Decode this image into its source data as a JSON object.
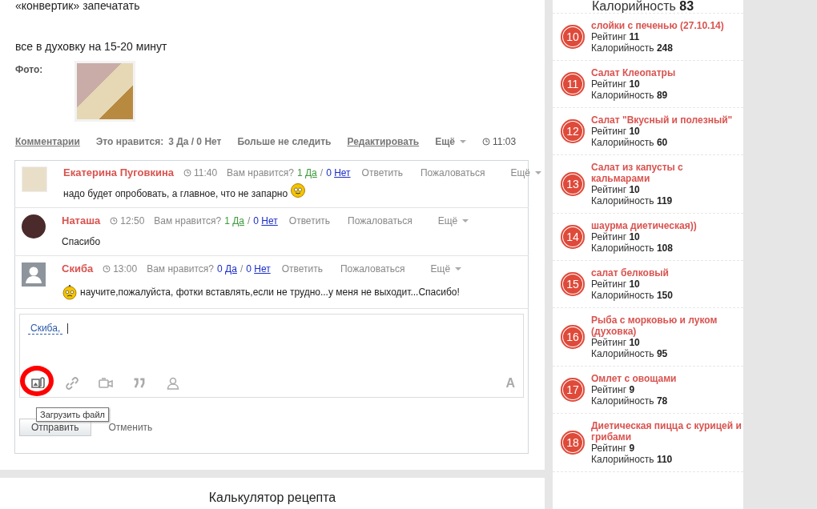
{
  "post": {
    "top_line": "«конвертик» запечатать",
    "instruction": "все в духовку на 15-20 минут",
    "photo_label": "Фото:"
  },
  "actions": {
    "comments": "Комментарии",
    "likes_label": "Это нравится:",
    "likes_value": "3 Да / 0 Нет",
    "unfollow": "Больше не следить",
    "edit": "Редактировать",
    "more": "Ещё",
    "time": "11:03"
  },
  "comments": [
    {
      "author": "Екатерина Пуговкина",
      "time": "11:40",
      "question": "Вам нравится?",
      "yes_count": "1",
      "yes": "Да",
      "yes_highlighted": true,
      "separator": "/",
      "no_count": "0",
      "no": "Нет",
      "reply": "Ответить",
      "report": "Пожаловаться",
      "more": "Ещё",
      "avatar": {
        "kind": "picture"
      },
      "content": [
        {
          "kind": "text",
          "text": "надо будет опробовать, а главное, что не запарно"
        },
        {
          "kind": "smiley"
        }
      ]
    },
    {
      "author": "Наташа",
      "time": "12:50",
      "question": "Вам нравится?",
      "yes_count": "1",
      "yes": "Да",
      "yes_highlighted": true,
      "separator": "/",
      "no_count": "0",
      "no": "Нет",
      "reply": "Ответить",
      "report": "Пожаловаться",
      "more": "Ещё",
      "avatar": {
        "kind": "photo"
      },
      "content": [
        {
          "kind": "text",
          "text": "Спасибо"
        }
      ]
    },
    {
      "author": "Скиба",
      "time": "13:00",
      "question": "Вам нравится?",
      "yes_count": "0",
      "yes": "Да",
      "yes_highlighted": false,
      "separator": "/",
      "no_count": "0",
      "no": "Нет",
      "reply": "Ответить",
      "report": "Пожаловаться",
      "more": "Ещё",
      "avatar": {
        "kind": "silhouette"
      },
      "content": [
        {
          "kind": "sad"
        },
        {
          "kind": "text",
          "text": "научите,пожалуйста, фотки вставлять,если не трудно...у меня не выходит...Спасибо!"
        }
      ]
    }
  ],
  "editor": {
    "mention": "Скиба,",
    "format_button": "A",
    "tooltip": "Загрузить файл",
    "submit": "Отправить",
    "cancel": "Отменить",
    "upload_highlighted": true
  },
  "calculator": {
    "title": "Калькулятор рецепта"
  },
  "sidebar": {
    "top_fragment": {
      "calories_label": "Калорийность",
      "calories": "83"
    },
    "items": [
      {
        "rank": "10",
        "title": "слойки с печенью (27.10.14)",
        "rating_label": "Рейтинг",
        "rating": "11",
        "calories_label": "Калорийность",
        "calories": "248"
      },
      {
        "rank": "11",
        "title": "Салат Клеопатры",
        "rating_label": "Рейтинг",
        "rating": "10",
        "calories_label": "Калорийность",
        "calories": "89"
      },
      {
        "rank": "12",
        "title": "Салат \"Вкусный и полезный\"",
        "rating_label": "Рейтинг",
        "rating": "10",
        "calories_label": "Калорийность",
        "calories": "60"
      },
      {
        "rank": "13",
        "title": "Салат из капусты с кальмарами",
        "rating_label": "Рейтинг",
        "rating": "10",
        "calories_label": "Калорийность",
        "calories": "119"
      },
      {
        "rank": "14",
        "title": "шаурма диетическая))",
        "rating_label": "Рейтинг",
        "rating": "10",
        "calories_label": "Калорийность",
        "calories": "108"
      },
      {
        "rank": "15",
        "title": "салат белковый",
        "rating_label": "Рейтинг",
        "rating": "10",
        "calories_label": "Калорийность",
        "calories": "150"
      },
      {
        "rank": "16",
        "title": "Рыба с морковью и луком (духовка)",
        "rating_label": "Рейтинг",
        "rating": "10",
        "calories_label": "Калорийность",
        "calories": "95"
      },
      {
        "rank": "17",
        "title": "Омлет с овощами",
        "rating_label": "Рейтинг",
        "rating": "9",
        "calories_label": "Калорийность",
        "calories": "78"
      },
      {
        "rank": "18",
        "title": "Диетическая пицца с курицей и грибами",
        "rating_label": "Рейтинг",
        "rating": "9",
        "calories_label": "Калорийность",
        "calories": "110"
      }
    ]
  }
}
